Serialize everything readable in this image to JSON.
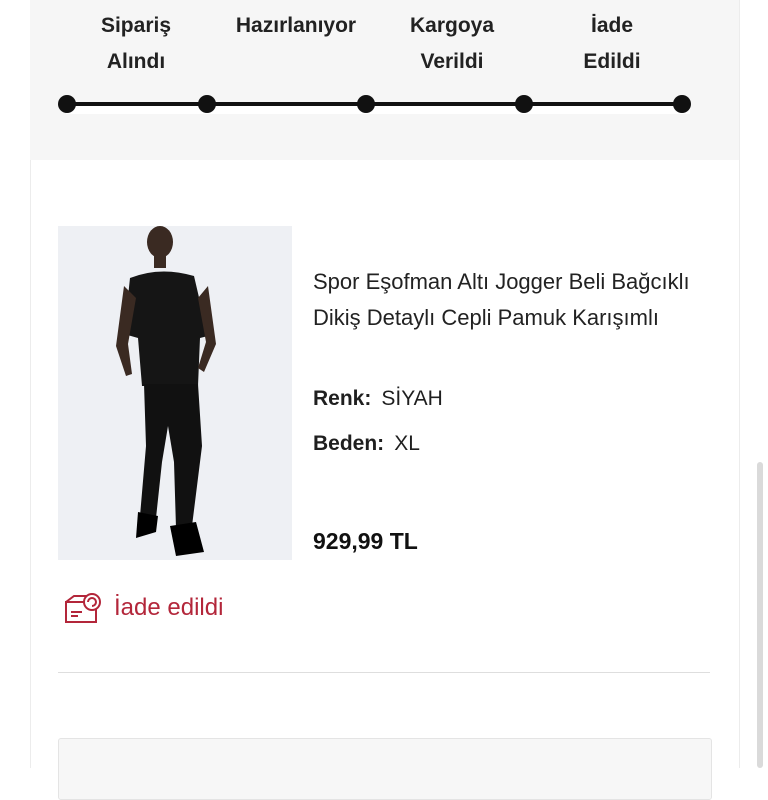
{
  "tracker": {
    "steps": [
      "Sipariş\nAlındı",
      "Hazırlanıyor",
      "Kargoya\nVerildi",
      "İade\nEdildi"
    ]
  },
  "product": {
    "title": "Spor Eşofman Altı Jogger Beli Bağcıklı Dikiş Detaylı Cepli Pamuk Karışımlı",
    "color_label": "Renk:",
    "color_value": "SİYAH",
    "size_label": "Beden:",
    "size_value": "XL",
    "price": "929,99 TL"
  },
  "status": {
    "text": "İade edildi",
    "color": "#b3263a"
  }
}
